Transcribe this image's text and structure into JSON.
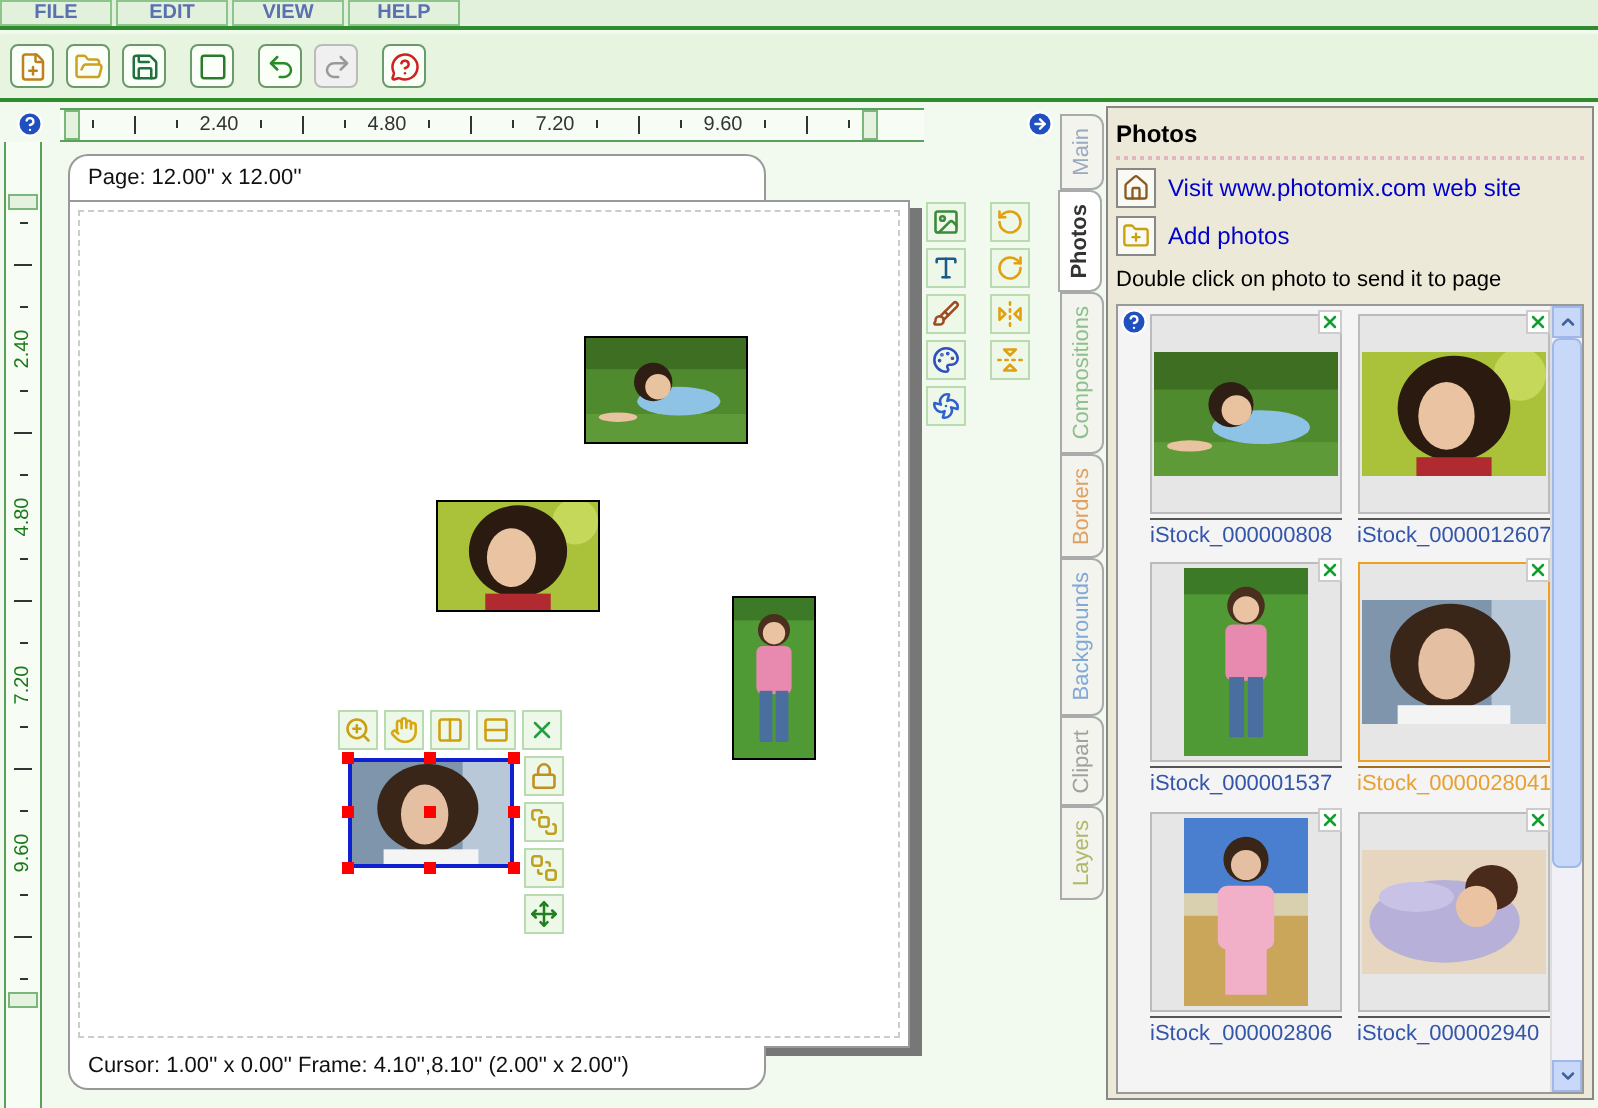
{
  "menu": [
    "FILE",
    "EDIT",
    "VIEW",
    "HELP"
  ],
  "toolbar": [
    {
      "disabled": false
    },
    {
      "disabled": false
    },
    {
      "disabled": false
    },
    {
      "disabled": false
    },
    {
      "disabled": false
    },
    {
      "disabled": true
    },
    {
      "disabled": false
    }
  ],
  "ruler": {
    "h_labels": [
      "2.40",
      "4.80",
      "7.20",
      "9.60"
    ],
    "v_labels": [
      "2.40",
      "4.80",
      "7.20",
      "9.60"
    ]
  },
  "page": {
    "title": "Page: 12.00'' x 12.00''",
    "status": "Cursor: 1.00'' x 0.00'' Frame: 4.10'',8.10'' (2.00'' x 2.00'')",
    "frames": [
      {
        "selected": false
      },
      {
        "selected": false
      },
      {
        "selected": false
      },
      {
        "selected": true
      }
    ]
  },
  "tabs": [
    {
      "label": "Main",
      "selected": false,
      "color": "#9aa8c0"
    },
    {
      "label": "Photos",
      "selected": true,
      "color": "#333333"
    },
    {
      "label": "Compositions",
      "selected": false,
      "color": "#8cc08c"
    },
    {
      "label": "Borders",
      "selected": false,
      "color": "#e0a060"
    },
    {
      "label": "Backgrounds",
      "selected": false,
      "color": "#80a8d8"
    },
    {
      "label": "Clipart",
      "selected": false,
      "color": "#a0a0a0"
    },
    {
      "label": "Layers",
      "selected": false,
      "color": "#b0b868"
    }
  ],
  "panel": {
    "title": "Photos",
    "links": [
      "Visit www.photomix.com web site",
      "Add photos"
    ],
    "hint": "Double click on photo to send it to page",
    "photos": [
      {
        "label": "iStock_000000808",
        "selected": false
      },
      {
        "label": "iStock_0000012607",
        "selected": false
      },
      {
        "label": "iStock_000001537",
        "selected": false
      },
      {
        "label": "iStock_0000028041",
        "selected": true
      },
      {
        "label": "iStock_000002806",
        "selected": false
      },
      {
        "label": "iStock_000002940",
        "selected": false
      }
    ]
  }
}
